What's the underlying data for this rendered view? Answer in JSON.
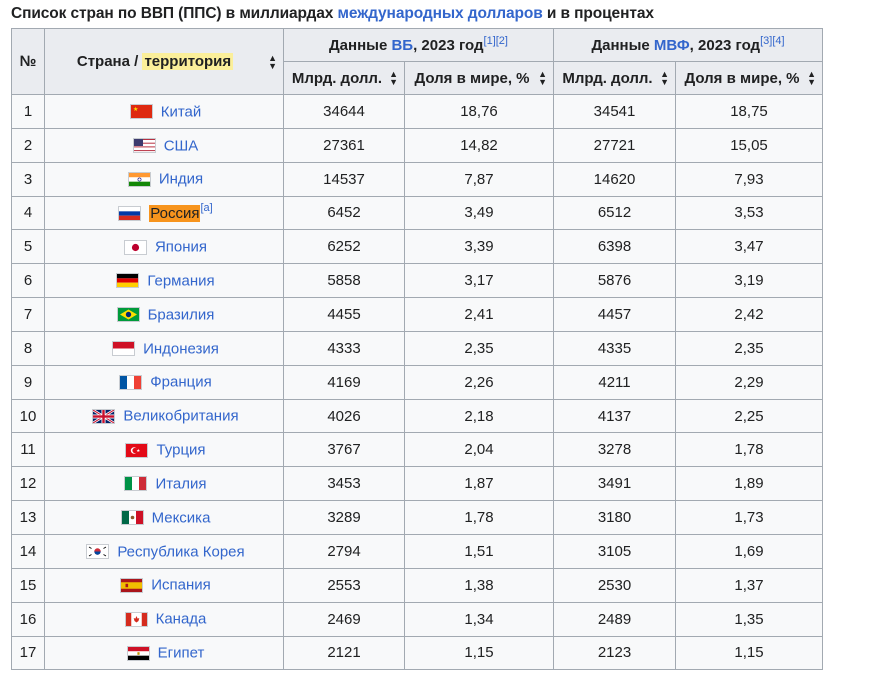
{
  "caption": {
    "before": "Список стран по ВВП (ППС) в миллиардах ",
    "link": "международных долларов",
    "after": " и в процентах"
  },
  "header": {
    "num": "№",
    "country_label": "Страна / ",
    "territory_label": "территория",
    "wb_prefix": "Данные ",
    "wb_link": "ВБ",
    "wb_suffix": ", 2023 год",
    "wb_ref": "[1][2]",
    "imf_prefix": "Данные ",
    "imf_link": "МВФ",
    "imf_suffix": ", 2023 год",
    "imf_ref": "[3][4]",
    "bn_label": "Млрд. долл.",
    "share_label": "Доля в мире, %"
  },
  "rows": [
    {
      "n": "1",
      "country": "Китай",
      "flag": "cn",
      "wb": "34644",
      "wbs": "18,76",
      "imf": "34541",
      "imfs": "18,75"
    },
    {
      "n": "2",
      "country": "США",
      "flag": "us",
      "wb": "27361",
      "wbs": "14,82",
      "imf": "27721",
      "imfs": "15,05"
    },
    {
      "n": "3",
      "country": "Индия",
      "flag": "in",
      "wb": "14537",
      "wbs": "7,87",
      "imf": "14620",
      "imfs": "7,93"
    },
    {
      "n": "4",
      "country": "Россия",
      "flag": "ru",
      "note": "[a]",
      "highlight": true,
      "wb": "6452",
      "wbs": "3,49",
      "imf": "6512",
      "imfs": "3,53"
    },
    {
      "n": "5",
      "country": "Япония",
      "flag": "jp",
      "wb": "6252",
      "wbs": "3,39",
      "imf": "6398",
      "imfs": "3,47"
    },
    {
      "n": "6",
      "country": "Германия",
      "flag": "de",
      "wb": "5858",
      "wbs": "3,17",
      "imf": "5876",
      "imfs": "3,19"
    },
    {
      "n": "7",
      "country": "Бразилия",
      "flag": "br",
      "wb": "4455",
      "wbs": "2,41",
      "imf": "4457",
      "imfs": "2,42"
    },
    {
      "n": "8",
      "country": "Индонезия",
      "flag": "id",
      "wb": "4333",
      "wbs": "2,35",
      "imf": "4335",
      "imfs": "2,35"
    },
    {
      "n": "9",
      "country": "Франция",
      "flag": "fr",
      "wb": "4169",
      "wbs": "2,26",
      "imf": "4211",
      "imfs": "2,29"
    },
    {
      "n": "10",
      "country": "Великобритания",
      "flag": "gb",
      "wb": "4026",
      "wbs": "2,18",
      "imf": "4137",
      "imfs": "2,25"
    },
    {
      "n": "11",
      "country": "Турция",
      "flag": "tr",
      "wb": "3767",
      "wbs": "2,04",
      "imf": "3278",
      "imfs": "1,78"
    },
    {
      "n": "12",
      "country": "Италия",
      "flag": "it",
      "wb": "3453",
      "wbs": "1,87",
      "imf": "3491",
      "imfs": "1,89"
    },
    {
      "n": "13",
      "country": "Мексика",
      "flag": "mx",
      "wb": "3289",
      "wbs": "1,78",
      "imf": "3180",
      "imfs": "1,73"
    },
    {
      "n": "14",
      "country": "Республика Корея",
      "flag": "kr",
      "wb": "2794",
      "wbs": "1,51",
      "imf": "3105",
      "imfs": "1,69"
    },
    {
      "n": "15",
      "country": "Испания",
      "flag": "es",
      "wb": "2553",
      "wbs": "1,38",
      "imf": "2530",
      "imfs": "1,37"
    },
    {
      "n": "16",
      "country": "Канада",
      "flag": "ca",
      "wb": "2469",
      "wbs": "1,34",
      "imf": "2489",
      "imfs": "1,35"
    },
    {
      "n": "17",
      "country": "Египет",
      "flag": "eg",
      "wb": "2121",
      "wbs": "1,15",
      "imf": "2123",
      "imfs": "1,15"
    }
  ],
  "colors": {
    "link": "#3366cc",
    "header_bg": "#eaecf0",
    "cell_bg": "#f8f9fa",
    "border": "#a2a9b1",
    "territory_highlight": "#fbef9a",
    "row_highlight": "#f7941d"
  }
}
